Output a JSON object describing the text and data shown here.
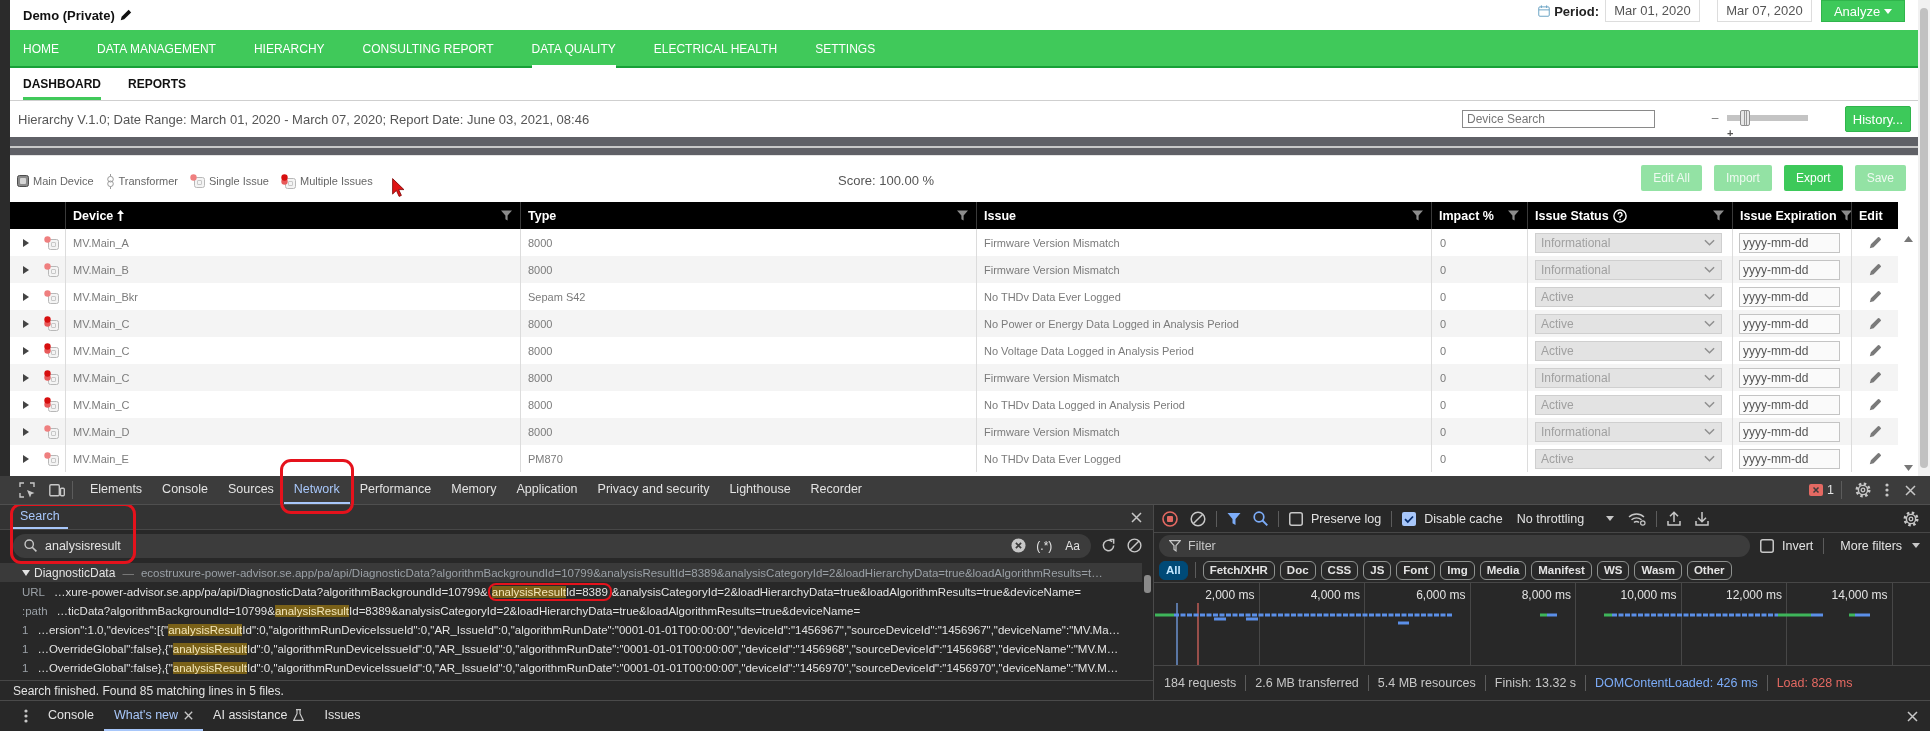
{
  "header": {
    "title": "Demo (Private)",
    "period_label": "Period:",
    "period_start": "Mar 01, 2020",
    "period_end": "Mar 07, 2020",
    "analyze_button": "Analyze"
  },
  "nav": [
    {
      "label": "HOME",
      "selected": false
    },
    {
      "label": "DATA MANAGEMENT",
      "selected": false
    },
    {
      "label": "HIERARCHY",
      "selected": false
    },
    {
      "label": "CONSULTING REPORT",
      "selected": false
    },
    {
      "label": "DATA QUALITY",
      "selected": true
    },
    {
      "label": "ELECTRICAL HEALTH",
      "selected": false
    },
    {
      "label": "SETTINGS",
      "selected": false
    }
  ],
  "subnav": [
    {
      "label": "DASHBOARD",
      "selected": true
    },
    {
      "label": "REPORTS",
      "selected": false
    }
  ],
  "info": {
    "text": "Hierarchy V.1.0; Date Range: March 01, 2020 - March 07, 2020; Report Date: June 03, 2021, 08:46",
    "device_search": {
      "placeholder": "Device Search"
    },
    "zoom": {
      "minus": "–",
      "plus": "+",
      "level": 0.18
    },
    "history_button": "History..."
  },
  "legend": [
    {
      "kind": "main_device",
      "label": "Main Device"
    },
    {
      "kind": "transformer",
      "label": "Transformer"
    },
    {
      "kind": "single_issue",
      "label": "Single Issue"
    },
    {
      "kind": "multiple_issues",
      "label": "Multiple Issues"
    }
  ],
  "score": "Score: 100.00 %",
  "actions": [
    {
      "label": "Edit All",
      "disabled": true
    },
    {
      "label": "Import",
      "disabled": true
    },
    {
      "label": "Export",
      "disabled": false
    },
    {
      "label": "Save",
      "disabled": true
    }
  ],
  "table": {
    "columns": [
      {
        "label": "Device",
        "sorted": true,
        "help": false,
        "filter": true
      },
      {
        "label": "Type",
        "sorted": false,
        "help": false,
        "filter": true
      },
      {
        "label": "Issue",
        "sorted": false,
        "help": false,
        "filter": true
      },
      {
        "label": "Impact %",
        "sorted": false,
        "help": false,
        "filter": true
      },
      {
        "label": "Issue Status",
        "sorted": false,
        "help": true,
        "filter": true
      },
      {
        "label": "Issue Expiration",
        "sorted": false,
        "help": false,
        "filter": true
      },
      {
        "label": "Edit",
        "sorted": false,
        "help": false,
        "filter": false
      }
    ],
    "rows": [
      {
        "expanded": false,
        "kind": "single_issue",
        "device": "MV.Main_A",
        "type": "8000",
        "issue": "Firmware Version Mismatch",
        "impact": "0",
        "status": "Informational",
        "status_disabled": true,
        "expiration": {
          "placeholder": "yyyy-mm-dd"
        }
      },
      {
        "expanded": false,
        "kind": "single_issue",
        "device": "MV.Main_B",
        "type": "8000",
        "issue": "Firmware Version Mismatch",
        "impact": "0",
        "status": "Informational",
        "status_disabled": true,
        "expiration": {
          "placeholder": "yyyy-mm-dd"
        }
      },
      {
        "expanded": false,
        "kind": "single_issue",
        "device": "MV.Main_Bkr",
        "type": "Sepam S42",
        "issue": "No THDv Data Ever Logged",
        "impact": "0",
        "status": "Active",
        "status_disabled": true,
        "expiration": {
          "placeholder": "yyyy-mm-dd"
        }
      },
      {
        "expanded": false,
        "kind": "multiple_issues",
        "device": "MV.Main_C",
        "type": "8000",
        "issue": "No Power or Energy Data Logged in Analysis Period",
        "impact": "0",
        "status": "Active",
        "status_disabled": true,
        "expiration": {
          "placeholder": "yyyy-mm-dd"
        }
      },
      {
        "expanded": false,
        "kind": "multiple_issues",
        "device": "MV.Main_C",
        "type": "8000",
        "issue": "No Voltage Data Logged in Analysis Period",
        "impact": "0",
        "status": "Active",
        "status_disabled": true,
        "expiration": {
          "placeholder": "yyyy-mm-dd"
        }
      },
      {
        "expanded": false,
        "kind": "multiple_issues",
        "device": "MV.Main_C",
        "type": "8000",
        "issue": "Firmware Version Mismatch",
        "impact": "0",
        "status": "Informational",
        "status_disabled": true,
        "expiration": {
          "placeholder": "yyyy-mm-dd"
        }
      },
      {
        "expanded": false,
        "kind": "multiple_issues",
        "device": "MV.Main_C",
        "type": "8000",
        "issue": "No THDv Data Logged in Analysis Period",
        "impact": "0",
        "status": "Active",
        "status_disabled": true,
        "expiration": {
          "placeholder": "yyyy-mm-dd"
        }
      },
      {
        "expanded": false,
        "kind": "single_issue",
        "device": "MV.Main_D",
        "type": "8000",
        "issue": "Firmware Version Mismatch",
        "impact": "0",
        "status": "Informational",
        "status_disabled": true,
        "expiration": {
          "placeholder": "yyyy-mm-dd"
        }
      },
      {
        "expanded": false,
        "kind": "single_issue",
        "device": "MV.Main_E",
        "type": "PM870",
        "issue": "No THDv Data Ever Logged",
        "impact": "0",
        "status": "Active",
        "status_disabled": true,
        "expiration": {
          "placeholder": "yyyy-mm-dd"
        }
      }
    ]
  },
  "devtools": {
    "tabs": [
      {
        "label": "Elements",
        "selected": false,
        "outlined": false
      },
      {
        "label": "Console",
        "selected": false,
        "outlined": false
      },
      {
        "label": "Sources",
        "selected": false,
        "outlined": false
      },
      {
        "label": "Network",
        "selected": true,
        "outlined": true
      },
      {
        "label": "Performance",
        "selected": false,
        "outlined": false
      },
      {
        "label": "Memory",
        "selected": false,
        "outlined": false
      },
      {
        "label": "Application",
        "selected": false,
        "outlined": false
      },
      {
        "label": "Privacy and security",
        "selected": false,
        "outlined": false
      },
      {
        "label": "Lighthouse",
        "selected": false,
        "outlined": false
      },
      {
        "label": "Recorder",
        "selected": false,
        "outlined": false
      }
    ],
    "error_count": "1",
    "search": {
      "outlined": true,
      "tab": {
        "label": "Search",
        "selected": true
      },
      "query": "analysisresult",
      "regex_toggle": "(.*)",
      "case_toggle": "Aa",
      "file": {
        "name": "DiagnosticData",
        "expanded": true,
        "selected": true,
        "separator": "—",
        "url": "ecostruxure-power-advisor.se.app/pa/api/DiagnosticData?algorithmBackgroundId=10799&analysisResultId=8389&analysisCategoryId=2&loadHierarchyData=true&loadAlgorithmResults=t…"
      },
      "matches": [
        {
          "line": "URL",
          "before": "…xure-power-advisor.se.app/pa/api/DiagnosticData?algorithmBackgroundId=10799&",
          "match": "analysisResult",
          "match_suffix": "Id=8389",
          "after": "&analysisCategoryId=2&loadHierarchyData=true&loadAlgorithmResults=true&deviceName=",
          "outlined": true
        },
        {
          "line": ":path",
          "before": "…ticData?algorithmBackgroundId=10799&",
          "match": "analysisResult",
          "after": "Id=8389&analysisCategoryId=2&loadHierarchyData=true&loadAlgorithmResults=true&deviceName=",
          "outlined": false
        },
        {
          "line": "1",
          "before": "…ersion\":1.0,\"devices\":[{\"",
          "match": "analysisResult",
          "after": "Id\":0,\"algorithmRunDeviceIssueId\":0,\"AR_IssueId\":0,\"algorithmRunDate\":\"0001-01-01T00:00:00\",\"deviceId\":\"1456967\",\"sourceDeviceId\":\"1456967\",\"deviceName\":\"MV.Ma…",
          "outlined": false
        },
        {
          "line": "1",
          "before": "…OverrideGlobal\":false},{\"",
          "match": "analysisResult",
          "after": "Id\":0,\"algorithmRunDeviceIssueId\":0,\"AR_IssueId\":0,\"algorithmRunDate\":\"0001-01-01T00:00:00\",\"deviceId\":\"1456968\",\"sourceDeviceId\":\"1456968\",\"deviceName\":\"MV.M…",
          "outlined": false
        },
        {
          "line": "1",
          "before": "…OverrideGlobal\":false},{\"",
          "match": "analysisResult",
          "after": "Id\":0,\"algorithmRunDeviceIssueId\":0,\"AR_IssueId\":0,\"algorithmRunDate\":\"0001-01-01T00:00:00\",\"deviceId\":\"1456970\",\"sourceDeviceId\":\"1456970\",\"deviceName\":\"MV.M…",
          "outlined": false
        }
      ],
      "status": "Search finished. Found 85 matching lines in 5 files."
    },
    "network": {
      "preserve_log": {
        "label": "Preserve log",
        "checked": false
      },
      "disable_cache": {
        "label": "Disable cache",
        "checked": true
      },
      "throttling": "No throttling",
      "filter": {
        "placeholder": "Filter"
      },
      "invert": {
        "label": "Invert",
        "checked": false
      },
      "more_filters": "More filters",
      "types": [
        {
          "label": "All",
          "selected": true
        },
        {
          "label": "Fetch/XHR",
          "selected": false
        },
        {
          "label": "Doc",
          "selected": false
        },
        {
          "label": "CSS",
          "selected": false
        },
        {
          "label": "JS",
          "selected": false
        },
        {
          "label": "Font",
          "selected": false
        },
        {
          "label": "Img",
          "selected": false
        },
        {
          "label": "Media",
          "selected": false
        },
        {
          "label": "Manifest",
          "selected": false
        },
        {
          "label": "WS",
          "selected": false
        },
        {
          "label": "Wasm",
          "selected": false
        },
        {
          "label": "Other",
          "selected": false
        }
      ],
      "timeline_ticks": [
        "2,000 ms",
        "4,000 ms",
        "6,000 ms",
        "8,000 ms",
        "10,000 ms",
        "12,000 ms",
        "14,000 ms"
      ],
      "summary": [
        {
          "text": "184 requests",
          "color": "#c7c7c7"
        },
        {
          "text": "2.6 MB transferred",
          "color": "#c7c7c7"
        },
        {
          "text": "5.4 MB resources",
          "color": "#c7c7c7"
        },
        {
          "text": "Finish: 13.32 s",
          "color": "#c7c7c7"
        },
        {
          "text": "DOMContentLoaded: 426 ms",
          "color": "#7cacf8"
        },
        {
          "text": "Load: 828 ms",
          "color": "#e46962"
        }
      ]
    },
    "drawer": {
      "tabs": [
        {
          "label": "Console",
          "selected": false,
          "closable": false,
          "experimental": false
        },
        {
          "label": "What's new",
          "selected": true,
          "closable": true,
          "experimental": false
        },
        {
          "label": "AI assistance",
          "selected": false,
          "closable": false,
          "experimental": true
        },
        {
          "label": "Issues",
          "selected": false,
          "closable": false,
          "experimental": false
        }
      ]
    }
  }
}
